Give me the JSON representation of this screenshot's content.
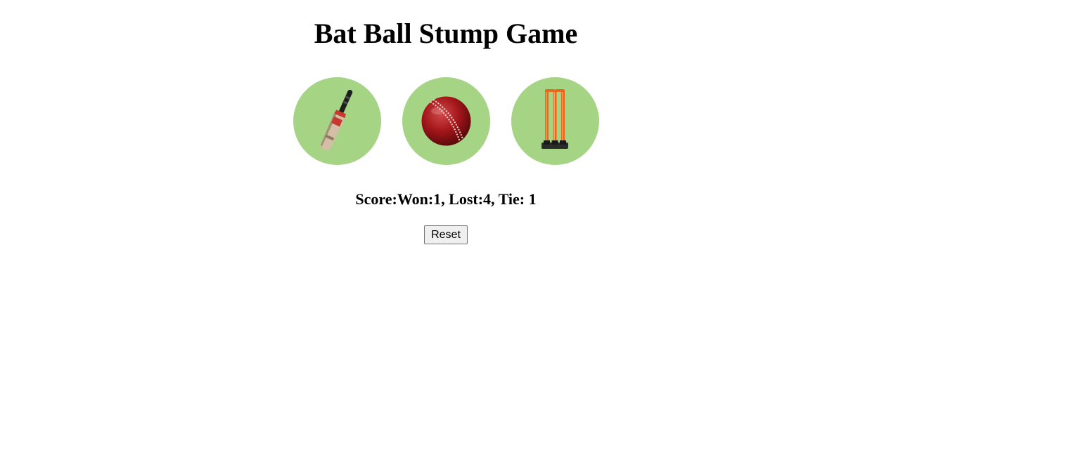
{
  "page": {
    "title": "Bat Ball Stump Game"
  },
  "choices": [
    {
      "name": "bat",
      "icon": "cricket-bat-icon"
    },
    {
      "name": "ball",
      "icon": "cricket-ball-icon"
    },
    {
      "name": "stump",
      "icon": "cricket-stumps-icon"
    }
  ],
  "colors": {
    "choice_bg": "#a5d485",
    "page_bg": "#ffffff"
  },
  "score": {
    "text": "Score:Won:1, Lost:4, Tie: 1",
    "won": 1,
    "lost": 4,
    "tie": 1
  },
  "reset": {
    "label": "Reset"
  }
}
